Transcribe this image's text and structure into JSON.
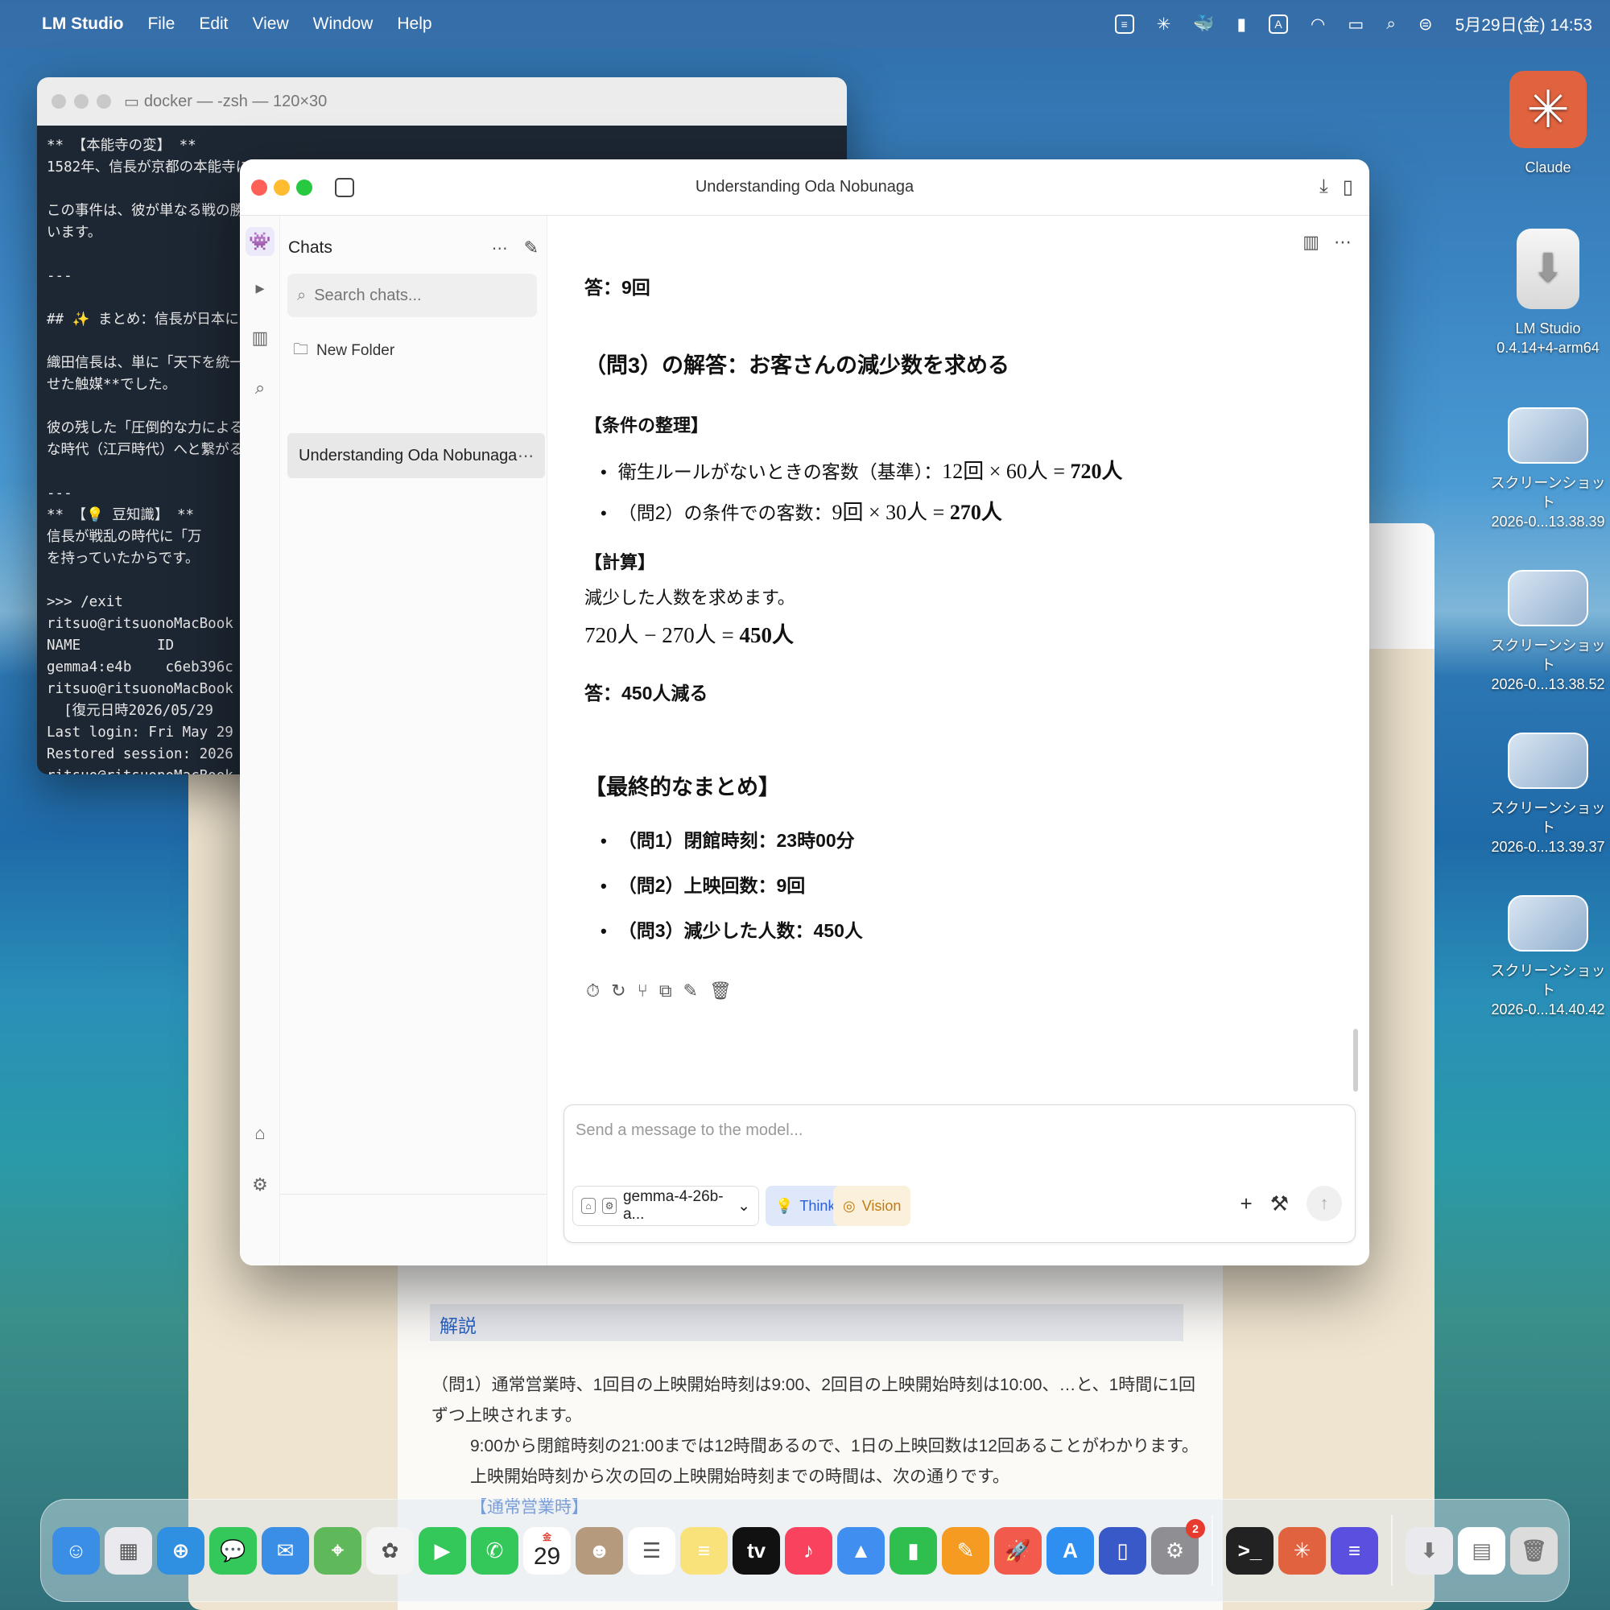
{
  "menubar": {
    "app_name": "LM Studio",
    "items": [
      "File",
      "Edit",
      "View",
      "Window",
      "Help"
    ],
    "clock": "5月29日(金) 14:53"
  },
  "desktop_icons": [
    {
      "label": "Claude",
      "icon": "claude-icon"
    },
    {
      "label": "LM Studio\n0.4.14+4-arm64",
      "icon": "drive-icon"
    },
    {
      "label": "スクリーンショット\n2026-0...13.38.39",
      "icon": "screenshot-icon"
    },
    {
      "label": "スクリーンショット\n2026-0...13.38.52",
      "icon": "screenshot-icon"
    },
    {
      "label": "スクリーンショット\n2026-0...13.39.37",
      "icon": "screenshot-icon"
    },
    {
      "label": "スクリーンショット\n2026-0...14.40.42",
      "icon": "screenshot-icon"
    }
  ],
  "terminal": {
    "title": "docker — -zsh — 120×30",
    "lines": [
      "** 【本能寺の変】 **",
      "1582年、信長が京都の本能寺に滞",
      "",
      "この事件は、彼が単なる戦の勝者",
      "います。",
      "",
      "---",
      "",
      "## ✨ まとめ：信長が日本にもた",
      "",
      "織田信長は、単に「天下を統一し",
      "せた触媒**でした。",
      "",
      "彼の残した「圧倒的な力による権",
      "な時代（江戸時代）へと繋がる最",
      "",
      "---",
      "** 【💡 豆知識】 **",
      "信長が戦乱の時代に「万",
      "を持っていたからです。",
      "",
      ">>> /exit",
      "ritsuo@ritsuonoMacBook",
      "NAME         ID",
      "gemma4:e4b    c6eb396c",
      "ritsuo@ritsuonoMacBook",
      "  [復元日時2026/05/29",
      "Last login: Fri May 29",
      "Restored session: 2026",
      "ritsuo@ritsuonoMacBook"
    ]
  },
  "lmstudio": {
    "window_title": "Understanding Oda Nobunaga",
    "sidebar": {
      "header": "Chats",
      "search_placeholder": "Search chats...",
      "new_folder": "New Folder",
      "chats": [
        {
          "title": "Understanding Oda Nobunaga",
          "selected": true
        }
      ]
    },
    "message": {
      "answer2": "答：9回",
      "q3_heading": "（問3）の解答：お客さんの減少数を求める",
      "conditions_heading": "【条件の整理】",
      "conditions": [
        {
          "text": "衛生ルールがないときの客数（基準）：",
          "math": "12回 × 60人 = ",
          "result": "720人"
        },
        {
          "text": "（問2）の条件での客数：",
          "math": "9回 × 30人 = ",
          "result": "270人"
        }
      ],
      "calc_heading": "【計算】",
      "calc_text": "減少した人数を求めます。",
      "calc_math": "720人 − 270人 = ",
      "calc_result": "450人",
      "answer3": "答：450人減る",
      "summary_heading": "【最終的なまとめ】",
      "summary": [
        "（問1）閉館時刻：23時00分",
        "（問2）上映回数：9回",
        "（問3）減少した人数：450人"
      ]
    },
    "composer": {
      "placeholder": "Send a message to the model...",
      "model": "gemma-4-26b-a...",
      "think_label": "Think",
      "vision_label": "Vision"
    }
  },
  "background_doc": {
    "section_label": "解説",
    "lines": [
      "（問1）通常営業時、1回目の上映開始時刻は9:00、2回目の上映開始時刻は10:00、…と、1時間に1回ずつ上映されます。",
      "9:00から閉館時刻の21:00までは12時間あるので、1日の上映回数は12回あることがわかります。",
      "上映開始時刻から次の回の上映開始時刻までの時間は、次の通りです。"
    ],
    "blue_label": "【通常営業時】"
  },
  "dock": {
    "calendar_day": "29",
    "calendar_month": "金",
    "settings_badge": "2",
    "apps": [
      {
        "name": "finder",
        "color": "#3a8ee6"
      },
      {
        "name": "launchpad",
        "color": "#e9e9ee"
      },
      {
        "name": "safari",
        "color": "#2f8fe0"
      },
      {
        "name": "messages",
        "color": "#34c759"
      },
      {
        "name": "mail",
        "color": "#3a8ee6"
      },
      {
        "name": "maps",
        "color": "#5fb85a"
      },
      {
        "name": "photos",
        "color": "#f4f4f4"
      },
      {
        "name": "facetime",
        "color": "#34c759"
      },
      {
        "name": "phone",
        "color": "#34c759"
      },
      {
        "name": "calendar",
        "color": "#ffffff"
      },
      {
        "name": "contacts",
        "color": "#b59a7e"
      },
      {
        "name": "reminders",
        "color": "#ffffff"
      },
      {
        "name": "notes",
        "color": "#f9e27a"
      },
      {
        "name": "tv",
        "color": "#111111"
      },
      {
        "name": "music",
        "color": "#f8425e"
      },
      {
        "name": "keynote",
        "color": "#3f8ef0"
      },
      {
        "name": "numbers",
        "color": "#2fbf4f"
      },
      {
        "name": "pages",
        "color": "#f59b22"
      },
      {
        "name": "rocket",
        "color": "#f25b4c"
      },
      {
        "name": "app-store",
        "color": "#2f8ff0"
      },
      {
        "name": "simulator",
        "color": "#3a59c9"
      },
      {
        "name": "system-settings",
        "color": "#8e8e93"
      }
    ],
    "apps_right": [
      {
        "name": "terminal",
        "color": "#222222"
      },
      {
        "name": "claude",
        "color": "#e0623e"
      },
      {
        "name": "lm-studio",
        "color": "#5b4fe0"
      }
    ]
  }
}
